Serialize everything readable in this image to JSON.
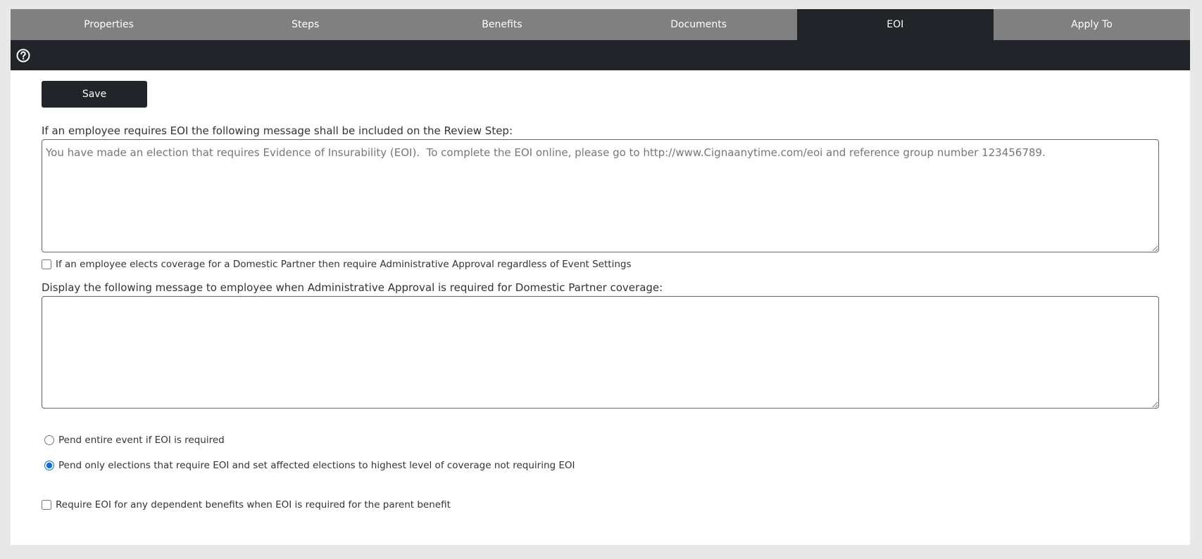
{
  "tabs": [
    {
      "label": "Properties",
      "active": false
    },
    {
      "label": "Steps",
      "active": false
    },
    {
      "label": "Benefits",
      "active": false
    },
    {
      "label": "Documents",
      "active": false
    },
    {
      "label": "EOI",
      "active": true
    },
    {
      "label": "Apply To",
      "active": false
    }
  ],
  "toolbar": {
    "help_icon": "question-circle-icon"
  },
  "actions": {
    "save_label": "Save"
  },
  "eoi_message": {
    "label": "If an employee requires EOI the following message shall be included on the Review Step:",
    "value": "You have made an election that requires Evidence of Insurability (EOI).  To complete the EOI online, please go to http://www.Cignaanytime.com/eoi and reference group number 123456789."
  },
  "domestic_partner": {
    "checkbox_label": "If an employee elects coverage for a Domestic Partner then require Administrative Approval regardless of Event Settings",
    "checked": false,
    "message_label": "Display the following message to employee when Administrative Approval is required for Domestic Partner coverage:",
    "message_value": ""
  },
  "pend_options": [
    {
      "label": "Pend entire event if EOI is required",
      "selected": false
    },
    {
      "label": "Pend only elections that require EOI and set affected elections to highest level of coverage not requiring EOI",
      "selected": true
    }
  ],
  "dependent_eoi": {
    "label": "Require EOI for any dependent benefits when EOI is required for the parent benefit",
    "checked": false
  },
  "colors": {
    "dark": "#212429",
    "tab_gray": "#808080",
    "radio_accent": "#0b6fd6"
  }
}
